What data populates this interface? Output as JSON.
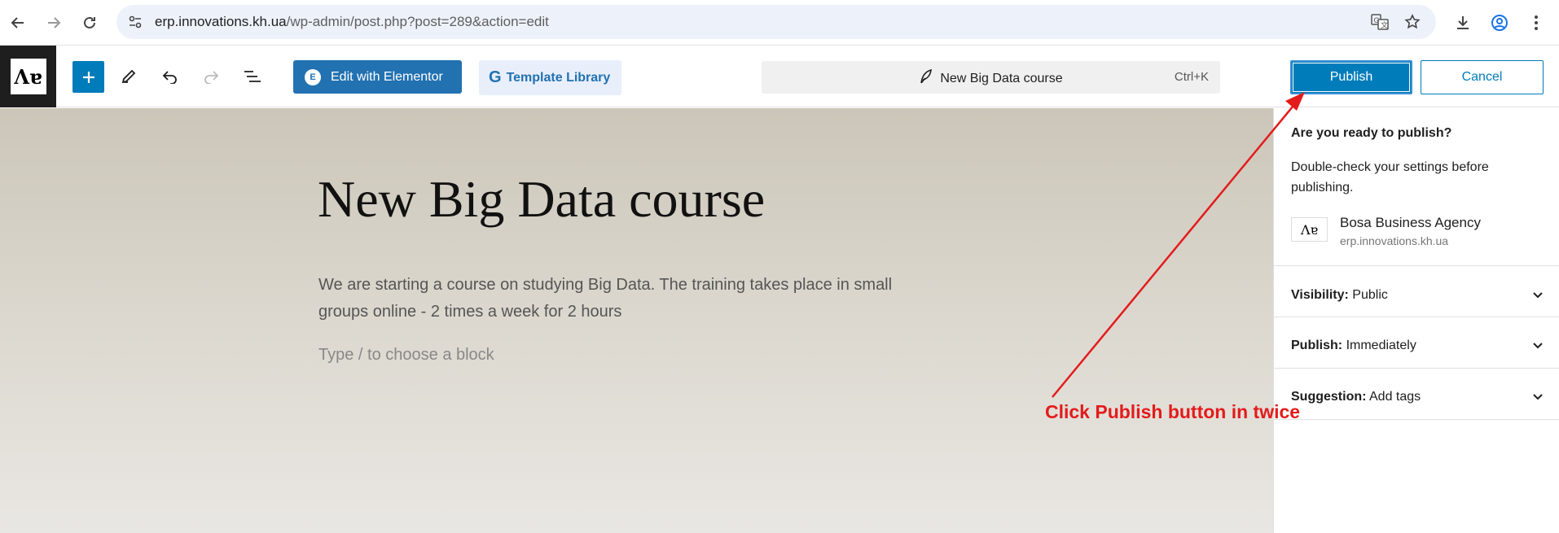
{
  "browser": {
    "url_host": "erp.innovations.kh.ua",
    "url_path": "/wp-admin/post.php?post=289&action=edit",
    "icons": [
      "back-icon",
      "forward-icon",
      "reload-icon",
      "site-info-icon",
      "translate-icon",
      "bookmark-star-icon",
      "download-icon",
      "profile-icon",
      "menu-dots-icon"
    ]
  },
  "header": {
    "site_logo": "Ʌɐ",
    "edit_elementor": "Edit with Elementor",
    "template_library": "Template Library",
    "document_title": "New Big Data course",
    "shortcut": "Ctrl+K",
    "publish": "Publish",
    "cancel": "Cancel"
  },
  "editor": {
    "title": "New Big Data course",
    "paragraph": "We are starting a course on studying Big Data. The training takes place in small groups online - 2 times a week for 2 hours",
    "placeholder": "Type / to choose a block"
  },
  "sidebar": {
    "question": "Are you ready to publish?",
    "description": "Double-check your settings before publishing.",
    "site_name": "Bosa Business Agency",
    "site_url": "erp.innovations.kh.ua",
    "rows": [
      {
        "label": "Visibility:",
        "value": "Public"
      },
      {
        "label": "Publish:",
        "value": "Immediately"
      },
      {
        "label": "Suggestion:",
        "value": "Add tags"
      }
    ]
  },
  "annotation": {
    "text": "Click Publish button in twice",
    "color": "#e31b1b"
  },
  "colors": {
    "accent": "#007cba",
    "elementor": "#2271b1"
  }
}
